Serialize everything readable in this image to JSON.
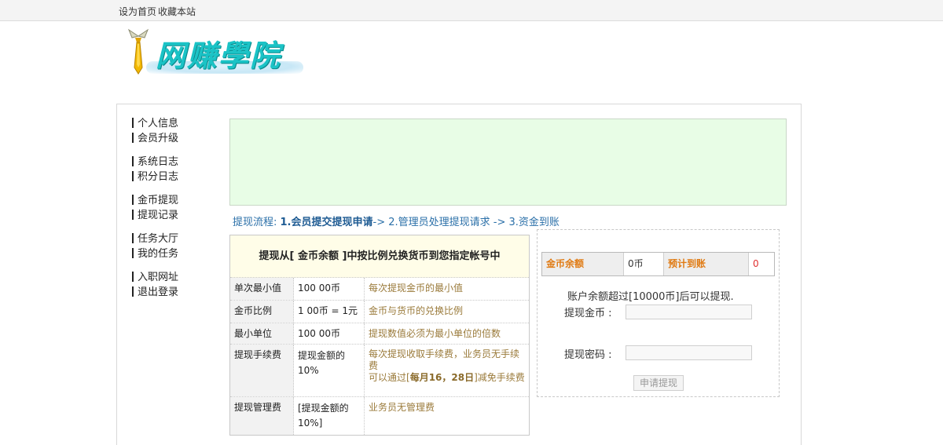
{
  "topbar": {
    "set_home": "设为首页",
    "bookmark": "收藏本站"
  },
  "logo": {
    "text": "网赚學院"
  },
  "sidebar": {
    "items": [
      {
        "label": "个人信息"
      },
      {
        "label": "会员升级"
      },
      {
        "label": "系统日志"
      },
      {
        "label": "积分日志"
      },
      {
        "label": "金币提现"
      },
      {
        "label": "提现记录"
      },
      {
        "label": "任务大厅"
      },
      {
        "label": "我的任务"
      },
      {
        "label": "入职网址"
      },
      {
        "label": "退出登录"
      }
    ]
  },
  "flow": {
    "prefix": "提现流程: ",
    "step1": "1.会员提交提现申请",
    "rest": "-> 2.管理员处理提现请求 -> 3.资金到账"
  },
  "rules": {
    "heading": "提现从[ 金币余额 ]中按比例兑换货币到您指定帐号中",
    "rows": [
      {
        "name": "单次最小值",
        "value": "100 00币",
        "desc": "每次提现金币的最小值"
      },
      {
        "name": "金币比例",
        "value": "1 00币 = 1元",
        "desc": "金币与货币的兑换比例"
      },
      {
        "name": "最小单位",
        "value": "100 00币",
        "desc": "提现数值必须为最小单位的倍数"
      },
      {
        "name": "提现手续费",
        "value": "提现金额的10%",
        "desc1": "每次提现收取手续费，业务员无手续费",
        "desc2_pre": "可以通过[",
        "desc2_bold": "每月16，28日",
        "desc2_post": "]减免手续费"
      },
      {
        "name": "提现管理费",
        "value": "[提现金额的10%]",
        "desc": "业务员无管理费"
      }
    ]
  },
  "balance": {
    "gold_label": "金币余额",
    "gold_value": "0币",
    "expected_label": "预计到账",
    "expected_value": "0"
  },
  "form": {
    "notice": "账户余额超过[10000币]后可以提现.",
    "amount_label": "提现金币 :",
    "amount_value": "",
    "password_label": "提现密码 :",
    "password_value": "",
    "submit_label": "申请提现"
  }
}
